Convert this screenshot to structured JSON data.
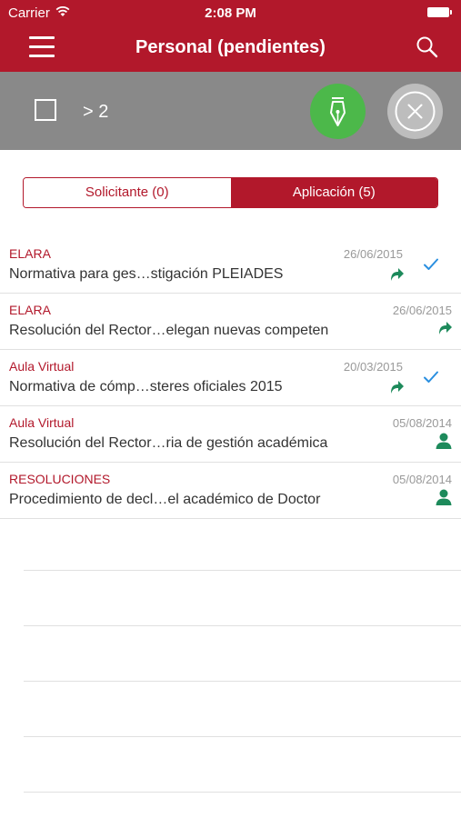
{
  "status_bar": {
    "carrier": "Carrier",
    "time": "2:08 PM"
  },
  "header": {
    "title": "Personal (pendientes)"
  },
  "action_bar": {
    "selection_count": "> 2"
  },
  "segments": {
    "left": "Solicitante (0)",
    "right": "Aplicación (5)"
  },
  "items": [
    {
      "source": "ELARA",
      "date": "26/06/2015",
      "subject": "Normativa para ges…stigación PLEIADES",
      "icons": [
        "forward-icon",
        "check-icon"
      ]
    },
    {
      "source": "ELARA",
      "date": "26/06/2015",
      "subject": "Resolución del Rector…elegan nuevas competen",
      "icons": [
        "forward-icon"
      ]
    },
    {
      "source": "Aula Virtual",
      "date": "20/03/2015",
      "subject": "Normativa de cómp…steres oficiales 2015",
      "icons": [
        "forward-icon",
        "check-icon"
      ]
    },
    {
      "source": "Aula Virtual",
      "date": "05/08/2014",
      "subject": "Resolución del Rector…ria de gestión académica",
      "icons": [
        "person-icon"
      ]
    },
    {
      "source": "RESOLUCIONES",
      "date": "05/08/2014",
      "subject": "Procedimiento de decl…el académico de Doctor",
      "icons": [
        "person-icon"
      ]
    }
  ],
  "colors": {
    "brand": "#b2182b",
    "action_bar": "#898989",
    "sign": "#4cb84a",
    "cancel": "#bdbdbd",
    "forward": "#1d8a5b",
    "check": "#2a8fe0"
  }
}
